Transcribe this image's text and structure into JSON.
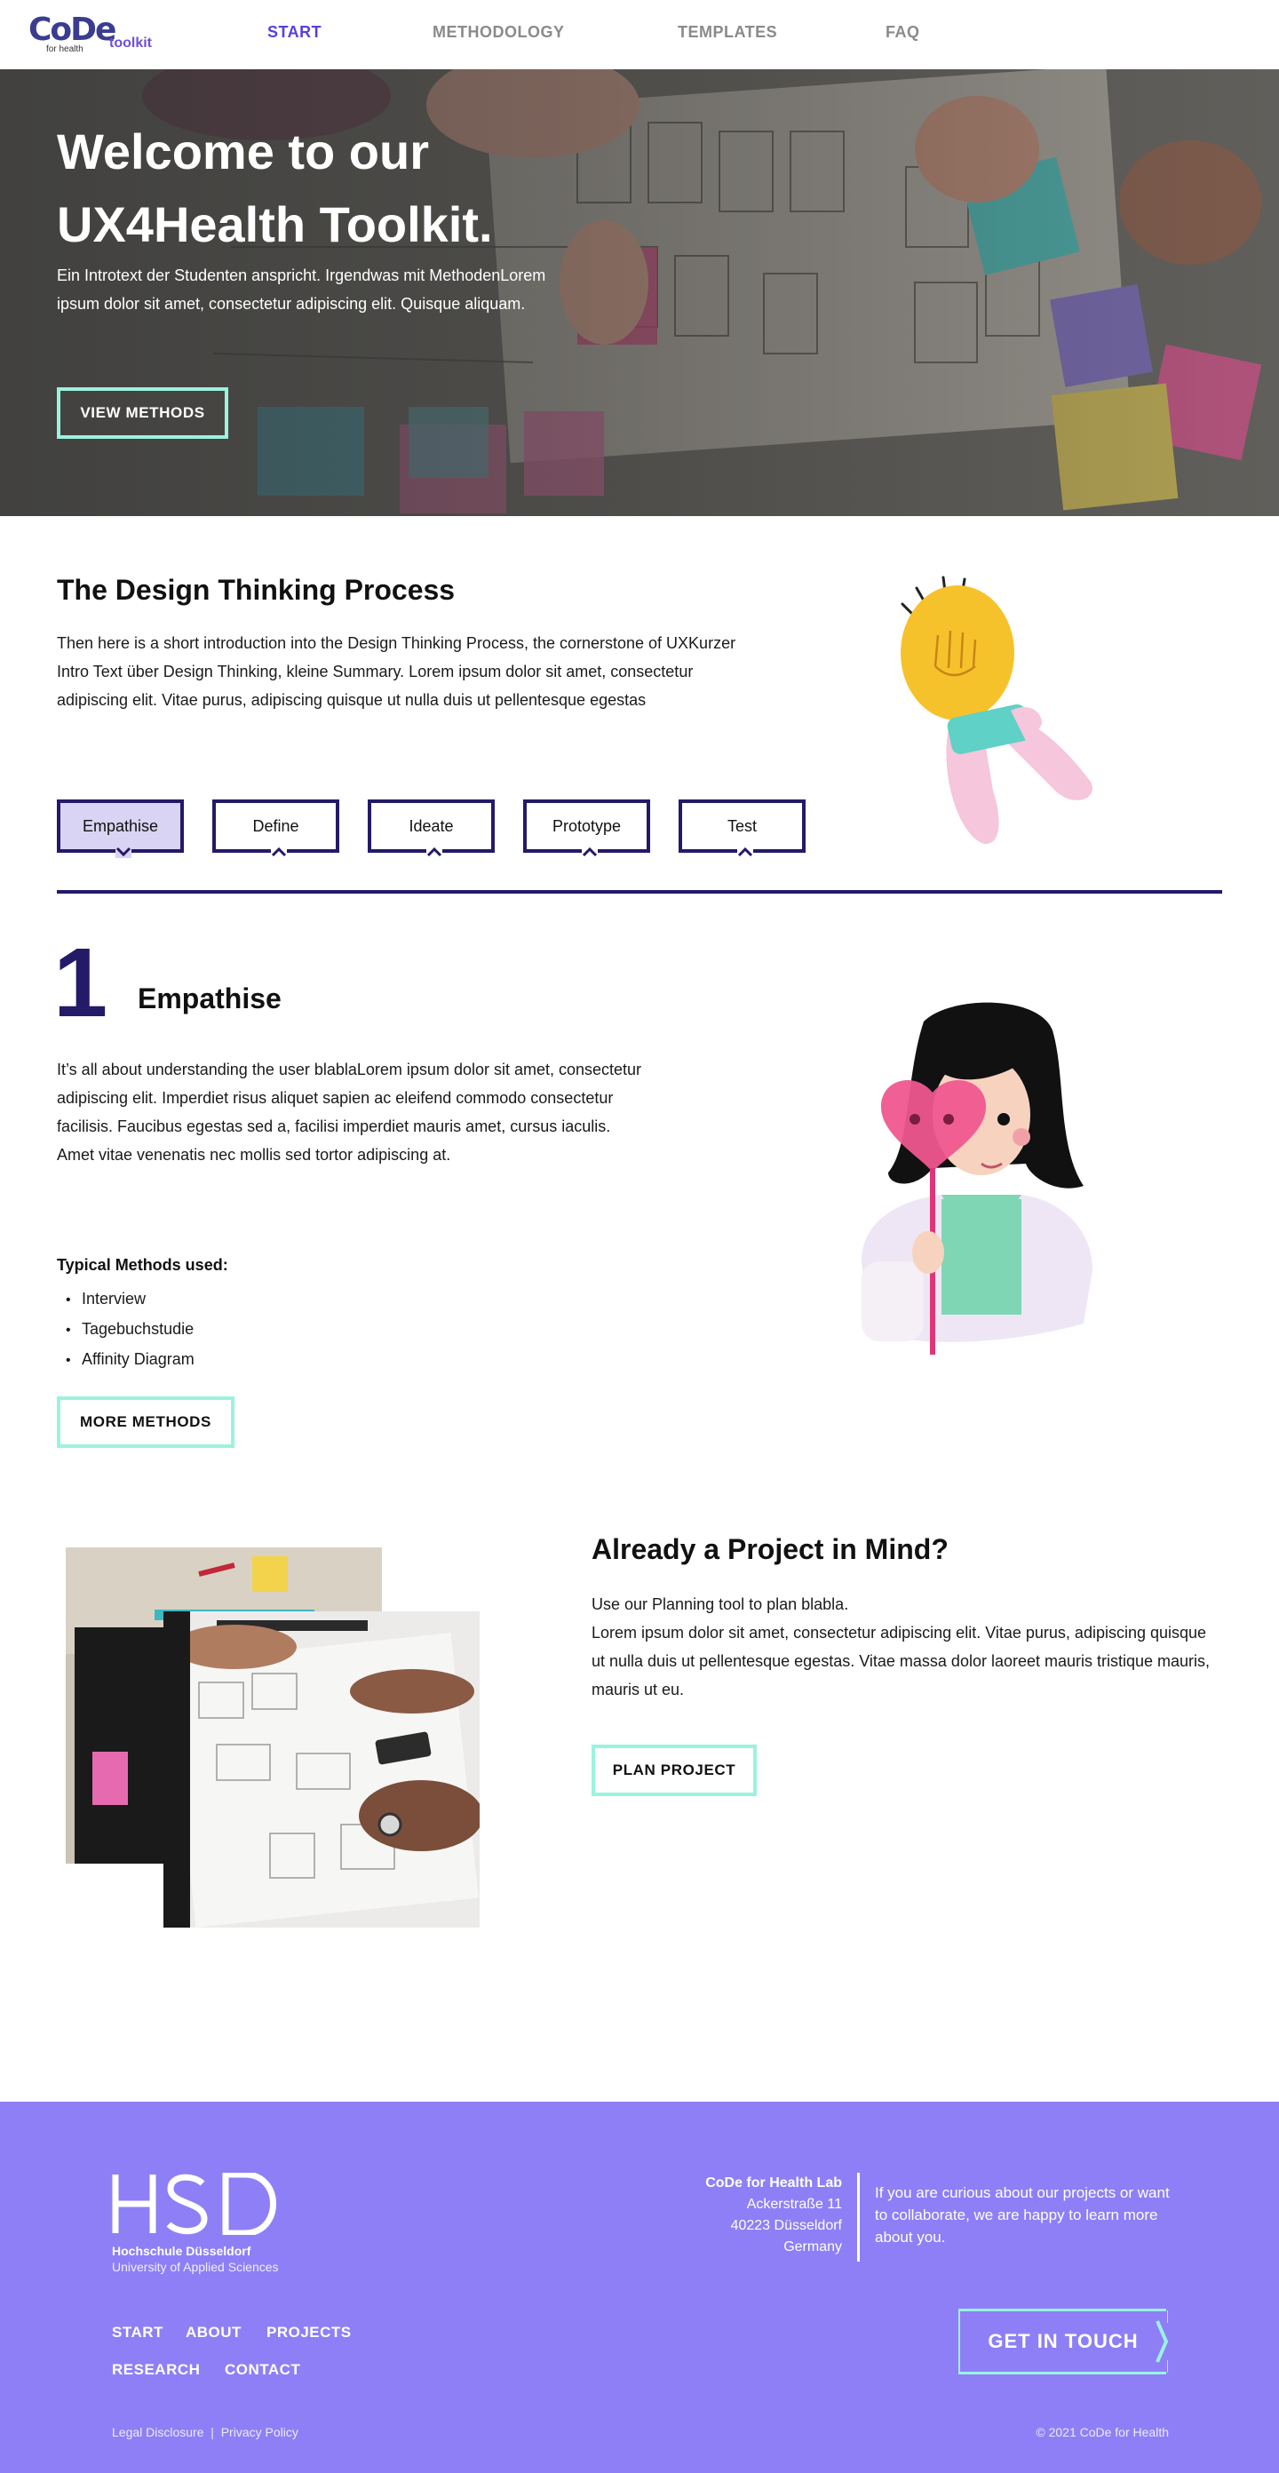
{
  "nav": {
    "logo_text": "CoDe",
    "logo_sub": "for health",
    "logo_toolkit": "toolkit",
    "links": [
      {
        "label": "START",
        "active": true
      },
      {
        "label": "METHODOLOGY",
        "active": false
      },
      {
        "label": "TEMPLATES",
        "active": false
      },
      {
        "label": "FAQ",
        "active": false
      }
    ]
  },
  "hero": {
    "title_line1": "Welcome to our",
    "title_line2": "UX4Health Toolkit.",
    "text": "Ein Introtext der Studenten anspricht. Irgendwas mit MethodenLorem ipsum dolor sit amet, consectetur adipiscing elit. Quisque aliquam.",
    "button": "VIEW METHODS"
  },
  "design_thinking": {
    "title": "The Design Thinking Process",
    "text": "Then here is a short introduction into the Design Thinking Process, the cornerstone of UXKurzer Intro Text über Design Thinking, kleine Summary.  Lorem ipsum dolor sit amet, consectetur adipiscing elit. Vitae purus, adipiscing quisque ut nulla duis ut pellentesque egestas",
    "tabs": [
      {
        "label": "Empathise",
        "active": true
      },
      {
        "label": "Define",
        "active": false
      },
      {
        "label": "Ideate",
        "active": false
      },
      {
        "label": "Prototype",
        "active": false
      },
      {
        "label": "Test",
        "active": false
      }
    ]
  },
  "empathise": {
    "number": "1",
    "title": "Empathise",
    "text": "It’s all about understanding the user blablaLorem ipsum dolor sit amet, consectetur adipiscing elit. Imperdiet risus aliquet sapien ac eleifend commodo consectetur facilisis. Faucibus egestas sed a, facilisi imperdiet mauris amet, cursus iaculis. Amet vitae venenatis nec mollis sed tortor adipiscing at.",
    "methods_heading": "Typical Methods used:",
    "methods": [
      "Interview",
      "Tagebuchstudie",
      "Affinity Diagram"
    ],
    "button": "MORE METHODS"
  },
  "project": {
    "title": "Already a Project in Mind?",
    "text_line1": "Use our Planning tool to plan blabla.",
    "text_line2": "Lorem ipsum dolor sit amet, consectetur adipiscing elit. Vitae purus, adipiscing quisque ut nulla duis ut pellentesque egestas. Vitae massa dolor laoreet mauris tristique mauris, mauris ut eu.",
    "button": "PLAN PROJECT"
  },
  "footer": {
    "hsd_name": "Hochschule Düsseldorf",
    "hsd_sub": "University of Applied Sciences",
    "address": {
      "org": "CoDe for Health Lab",
      "street": "Ackerstraße 11",
      "city": "40223 Düsseldorf",
      "country": "Germany"
    },
    "contact_text": "If you are curious about our projects or want to collaborate, we are happy to learn more about you.",
    "links": [
      "START",
      "ABOUT",
      "PROJECTS",
      "RESEARCH",
      "CONTACT"
    ],
    "cta": "GET IN TOUCH",
    "legal": "Legal Disclosure",
    "privacy": "Privacy Policy",
    "separator": "|",
    "copyright": "© 2021 CoDe for Health"
  },
  "colors": {
    "brand_purple": "#5b3ee0",
    "navy": "#231a68",
    "mint": "#9af3df",
    "footer_bg": "#8e7ff7",
    "tab_active_bg": "#d9d4f3"
  }
}
